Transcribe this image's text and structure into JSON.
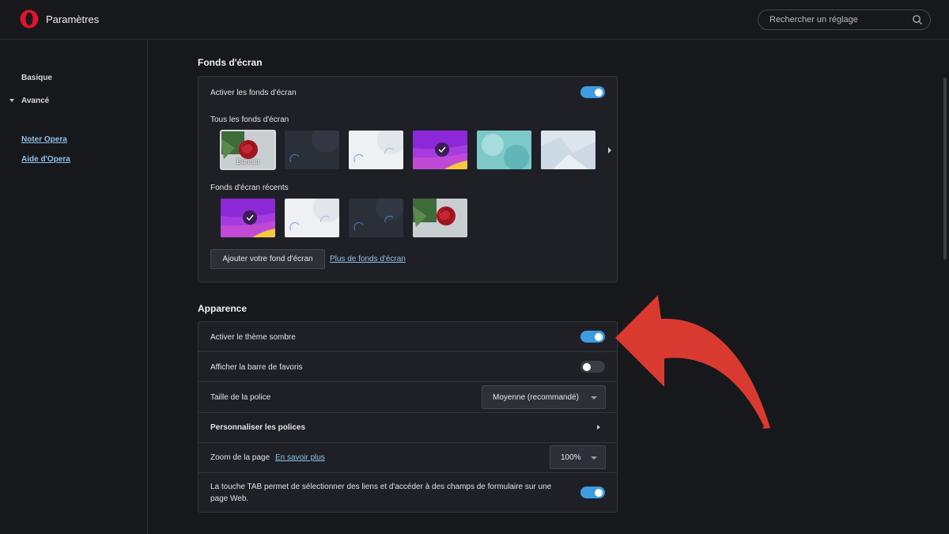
{
  "header": {
    "title": "Paramètres",
    "search_placeholder": "Rechercher un réglage"
  },
  "sidebar": {
    "basic": "Basique",
    "advanced": "Avancé",
    "rate_link": "Noter Opera",
    "help_link": "Aide d'Opera"
  },
  "wallpapers": {
    "section_title": "Fonds d'écran",
    "enable_label": "Activer les fonds d'écran",
    "enable_on": true,
    "all_label": "Tous les fonds d'écran",
    "first_caption": "Bureau",
    "recent_label": "Fonds d'écran récents",
    "add_button": "Ajouter votre fond d'écran",
    "more_link": "Plus de fonds d'écran"
  },
  "appearance": {
    "section_title": "Apparence",
    "dark_theme_label": "Activer le thème sombre",
    "dark_theme_on": true,
    "favorites_bar_label": "Afficher la barre de favoris",
    "favorites_bar_on": false,
    "font_size_label": "Taille de la police",
    "font_size_value": "Moyenne (recommandé)",
    "customize_fonts_label": "Personnaliser les polices",
    "zoom_label": "Zoom de la page",
    "zoom_link": "En savoir plus",
    "zoom_value": "100%",
    "tab_label_line1": "La touche TAB permet de sélectionner des liens et d'accéder à des champs de formulaire sur une",
    "tab_label_line2": "page Web.",
    "tab_on": true
  },
  "colors": {
    "accent": "#3f9be0",
    "link": "#8fc0ea",
    "annotation_arrow": "#d93a2f"
  }
}
